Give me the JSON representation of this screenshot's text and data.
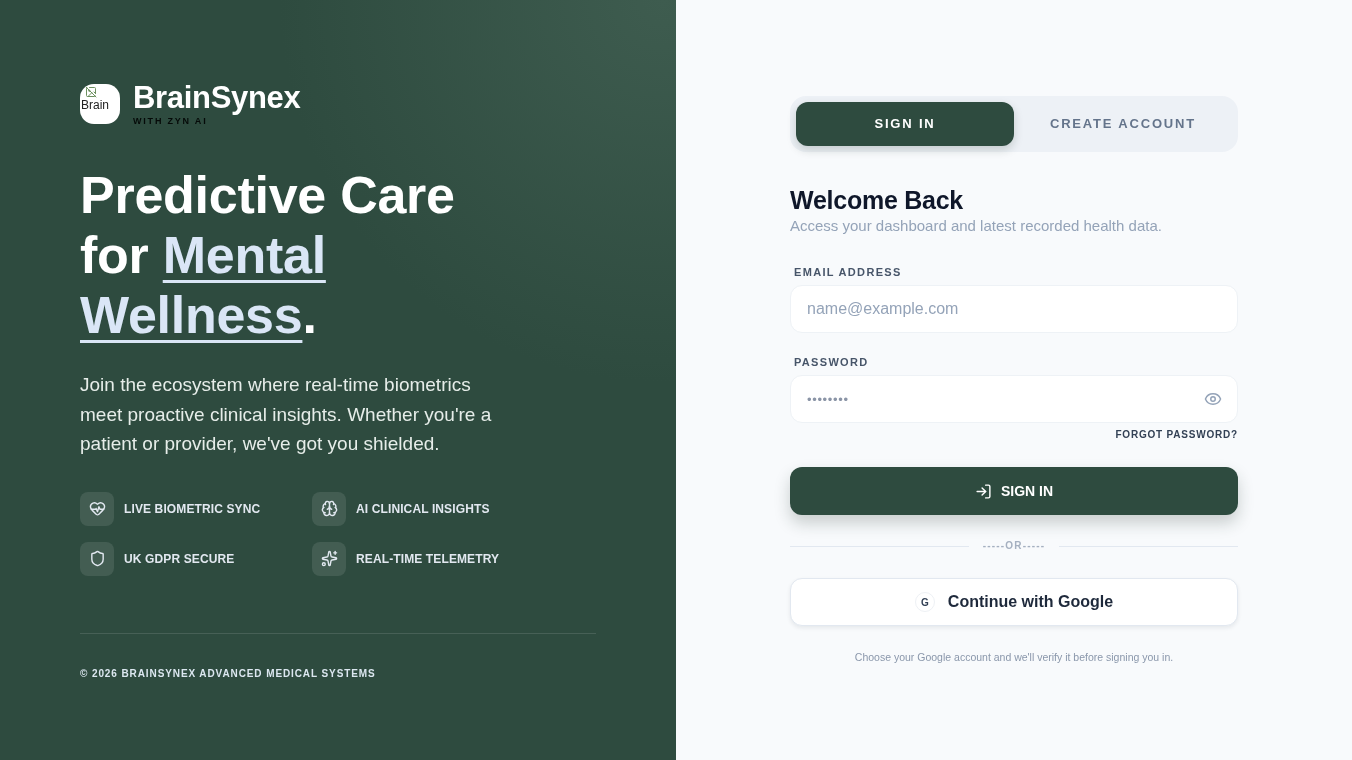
{
  "brand": {
    "logo_alt": "Brain",
    "name": "BrainSynex",
    "tagline": "WITH ZYN AI"
  },
  "hero": {
    "headline_start": "Predictive Care for ",
    "headline_highlight": "Mental Wellness",
    "headline_end": ".",
    "description": "Join the ecosystem where real-time biometrics meet proactive clinical insights. Whether you're a patient or provider, we've got you shielded."
  },
  "features": [
    "LIVE BIOMETRIC SYNC",
    "AI CLINICAL INSIGHTS",
    "UK GDPR SECURE",
    "REAL-TIME TELEMETRY"
  ],
  "footer": "© 2026 BRAINSYNEX ADVANCED MEDICAL SYSTEMS",
  "tabs": [
    {
      "label": "SIGN IN",
      "selected": true
    },
    {
      "label": "CREATE ACCOUNT",
      "selected": false
    }
  ],
  "form": {
    "title": "Welcome Back",
    "subtitle": "Access your dashboard and latest recorded health data.",
    "fields": [
      {
        "kind": "email",
        "label": "EMAIL ADDRESS",
        "placeholder": "name@example.com"
      },
      {
        "kind": "password",
        "label": "PASSWORD",
        "value": "••••••••"
      }
    ],
    "forgot_link": "FORGOT PASSWORD?",
    "submit": "SIGN IN",
    "divider": "-----OR-----",
    "google_button": {
      "mark": "G",
      "label": "Continue with Google"
    },
    "note": "Choose your Google account and we'll verify it before signing you in."
  }
}
